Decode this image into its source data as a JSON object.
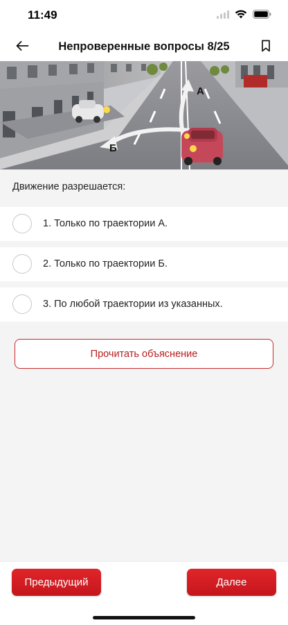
{
  "status_bar": {
    "time": "11:49"
  },
  "nav": {
    "title": "Непроверенные вопросы 8/25"
  },
  "scene": {
    "label_a": "А",
    "label_b": "Б"
  },
  "question": {
    "text": "Движение разрешается:"
  },
  "answers": [
    {
      "text": "1. Только по траектории А.",
      "selected": false
    },
    {
      "text": "2. Только по траектории Б.",
      "selected": false
    },
    {
      "text": "3. По любой траектории из указанных.",
      "selected": false
    }
  ],
  "explain_button": {
    "label": "Прочитать объяснение"
  },
  "footer": {
    "prev_label": "Предыдущий",
    "next_label": "Далее"
  },
  "colors": {
    "accent": "#d0191f",
    "background": "#f4f4f4"
  },
  "icons": [
    "wifi-icon",
    "battery-icon",
    "cellular-icon",
    "back-arrow-icon",
    "bookmark-icon"
  ]
}
